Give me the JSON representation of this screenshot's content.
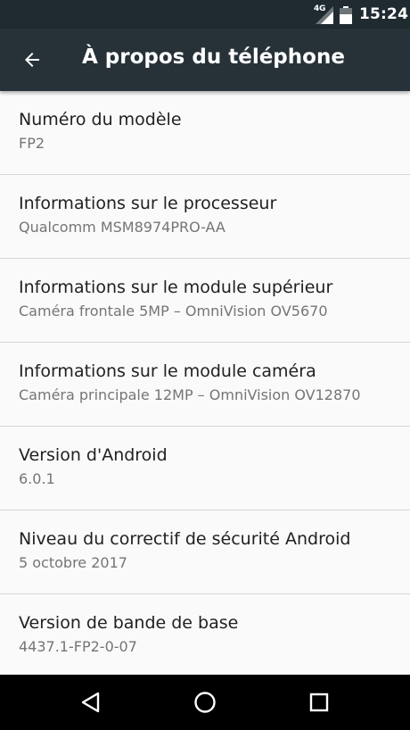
{
  "status_bar": {
    "network_type": "4G",
    "time": "15:24",
    "icons": [
      "signal-icon",
      "battery-icon"
    ]
  },
  "toolbar": {
    "back_icon": "arrow-back-icon",
    "title": "À propos du téléphone"
  },
  "items": [
    {
      "title": "Numéro du modèle",
      "summary": "FP2"
    },
    {
      "title": "Informations sur le processeur",
      "summary": "Qualcomm MSM8974PRO-AA"
    },
    {
      "title": "Informations sur le module supérieur",
      "summary": "Caméra frontale 5MP – OmniVision OV5670"
    },
    {
      "title": "Informations sur le module caméra",
      "summary": "Caméra principale 12MP – OmniVision OV12870"
    },
    {
      "title": "Version d'Android",
      "summary": "6.0.1"
    },
    {
      "title": "Niveau du correctif de sécurité Android",
      "summary": "5 octobre 2017"
    },
    {
      "title": "Version de bande de base",
      "summary": "4437.1-FP2-0-07"
    }
  ],
  "nav_bar": {
    "icons": [
      "back-triangle-icon",
      "home-circle-icon",
      "recents-square-icon"
    ]
  },
  "colors": {
    "status_bar": "#1f2b30",
    "toolbar": "#263238",
    "background": "#fafafa",
    "title_text": "#212121",
    "summary_text": "#757575",
    "divider": "#d6d6d6",
    "nav_bar": "#000000"
  }
}
